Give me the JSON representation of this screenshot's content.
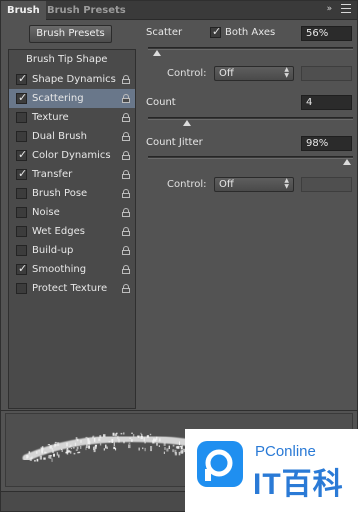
{
  "tabs": [
    {
      "label": "Brush"
    },
    {
      "label": "Brush Presets"
    }
  ],
  "header_icons": {
    "collapse": "»",
    "menu": "menu-icon"
  },
  "presets_button": "Brush Presets",
  "tip_shape_header": "Brush Tip Shape",
  "options": [
    {
      "label": "Shape Dynamics",
      "checked": true
    },
    {
      "label": "Scattering",
      "checked": true,
      "selected": true
    },
    {
      "label": "Texture",
      "checked": false
    },
    {
      "label": "Dual Brush",
      "checked": false
    },
    {
      "label": "Color Dynamics",
      "checked": true
    },
    {
      "label": "Transfer",
      "checked": true
    },
    {
      "label": "Brush Pose",
      "checked": false
    },
    {
      "label": "Noise",
      "checked": false
    },
    {
      "label": "Wet Edges",
      "checked": false
    },
    {
      "label": "Build-up",
      "checked": false
    },
    {
      "label": "Smoothing",
      "checked": true
    },
    {
      "label": "Protect Texture",
      "checked": false
    }
  ],
  "scatter": {
    "label": "Scatter",
    "both_axes_label": "Both Axes",
    "both_axes_checked": true,
    "value": "56%",
    "control_label": "Control:",
    "control_value": "Off"
  },
  "count": {
    "label": "Count",
    "value": "4"
  },
  "count_jitter": {
    "label": "Count Jitter",
    "value": "98%",
    "control_label": "Control:",
    "control_value": "Off"
  },
  "watermark": {
    "line1": "PConline",
    "line2": "IT百科"
  },
  "colors": {
    "panel_bg": "#535353",
    "selected_row": "#69778a",
    "watermark_blue": "#1f8ff0"
  }
}
